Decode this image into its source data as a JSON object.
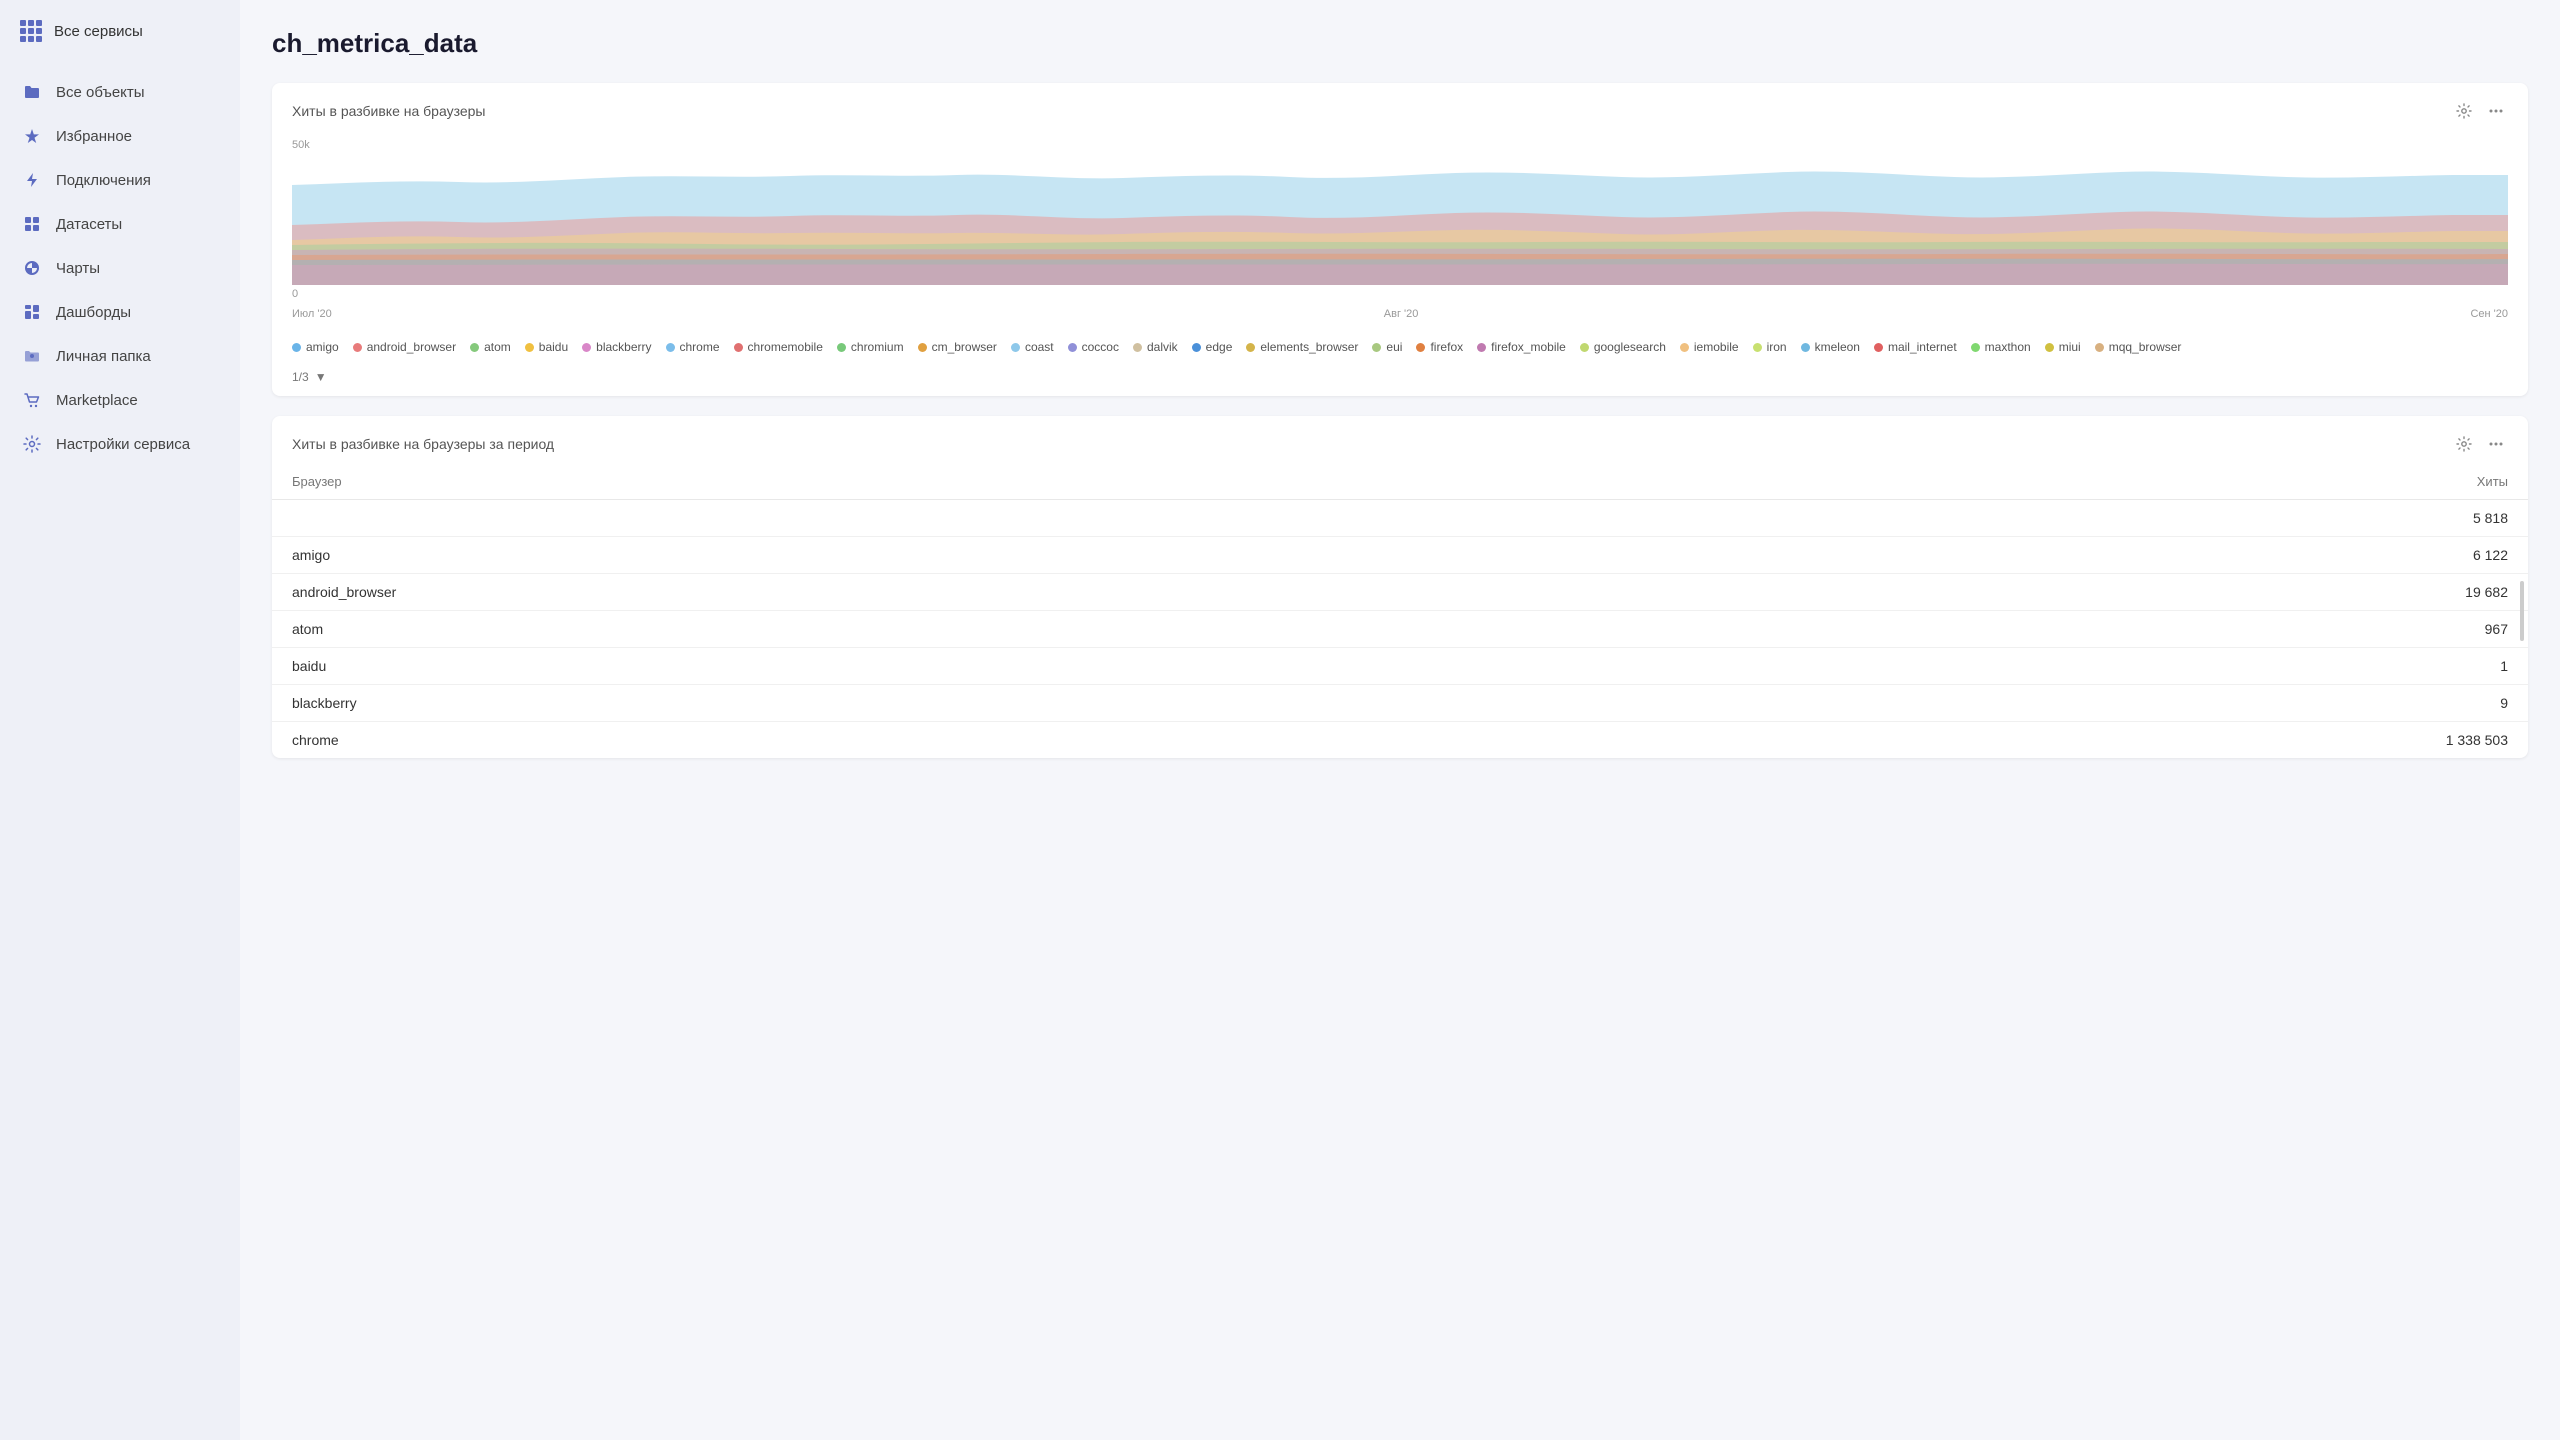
{
  "sidebar": {
    "app_menu_label": "Все сервисы",
    "items": [
      {
        "id": "all-objects",
        "label": "Все объекты",
        "icon": "folder"
      },
      {
        "id": "favorites",
        "label": "Избранное",
        "icon": "star"
      },
      {
        "id": "connections",
        "label": "Подключения",
        "icon": "bolt"
      },
      {
        "id": "datasets",
        "label": "Датасеты",
        "icon": "grid"
      },
      {
        "id": "charts",
        "label": "Чарты",
        "icon": "pie"
      },
      {
        "id": "dashboards",
        "label": "Дашборды",
        "icon": "dashboard"
      },
      {
        "id": "personal-folder",
        "label": "Личная папка",
        "icon": "user-folder"
      },
      {
        "id": "marketplace",
        "label": "Marketplace",
        "icon": "cart"
      },
      {
        "id": "settings",
        "label": "Настройки сервиса",
        "icon": "settings"
      }
    ]
  },
  "page": {
    "title": "ch_metrica_data"
  },
  "chart1": {
    "title": "Хиты в разбивке на браузеры",
    "y_max": "50k",
    "y_min": "0",
    "x_labels": [
      "Июл '20",
      "Авг '20",
      "Сен '20"
    ],
    "legend": [
      {
        "label": "amigo",
        "color": "#6ab4e8"
      },
      {
        "label": "android_browser",
        "color": "#e87b7b"
      },
      {
        "label": "atom",
        "color": "#85c97c"
      },
      {
        "label": "baidu",
        "color": "#f0c040"
      },
      {
        "label": "blackberry",
        "color": "#d987c8"
      },
      {
        "label": "chrome",
        "color": "#7bbdea"
      },
      {
        "label": "chromemobile",
        "color": "#e07070"
      },
      {
        "label": "chromium",
        "color": "#78c97a"
      },
      {
        "label": "cm_browser",
        "color": "#e0a040"
      },
      {
        "label": "coast",
        "color": "#8ec8ea"
      },
      {
        "label": "coccoc",
        "color": "#9090d8"
      },
      {
        "label": "dalvik",
        "color": "#d0c0a0"
      },
      {
        "label": "edge",
        "color": "#4a90d9"
      },
      {
        "label": "elements_browser",
        "color": "#d4b44a"
      },
      {
        "label": "eui",
        "color": "#a8c880"
      },
      {
        "label": "firefox",
        "color": "#e08040"
      },
      {
        "label": "firefox_mobile",
        "color": "#c07ab0"
      },
      {
        "label": "googlesearch",
        "color": "#c0d870"
      },
      {
        "label": "iemobile",
        "color": "#f0c080"
      },
      {
        "label": "iron",
        "color": "#c8e070"
      },
      {
        "label": "kmeleon",
        "color": "#70b8e0"
      },
      {
        "label": "mail_internet",
        "color": "#e06060"
      },
      {
        "label": "maxthon",
        "color": "#80d870"
      },
      {
        "label": "miui",
        "color": "#d0c040"
      },
      {
        "label": "mqq_browser",
        "color": "#d8b080"
      }
    ],
    "pagination": "1/3",
    "gear_label": "⚙",
    "more_label": "···"
  },
  "chart2": {
    "title": "Хиты в разбивке на браузеры за период",
    "col_browser": "Браузер",
    "col_hits": "Хиты",
    "gear_label": "⚙",
    "more_label": "···",
    "rows": [
      {
        "browser": "",
        "hits": "5 818"
      },
      {
        "browser": "amigo",
        "hits": "6 122"
      },
      {
        "browser": "android_browser",
        "hits": "19 682"
      },
      {
        "browser": "atom",
        "hits": "967"
      },
      {
        "browser": "baidu",
        "hits": "1"
      },
      {
        "browser": "blackberry",
        "hits": "9"
      },
      {
        "browser": "chrome",
        "hits": "1 338 503"
      }
    ]
  }
}
